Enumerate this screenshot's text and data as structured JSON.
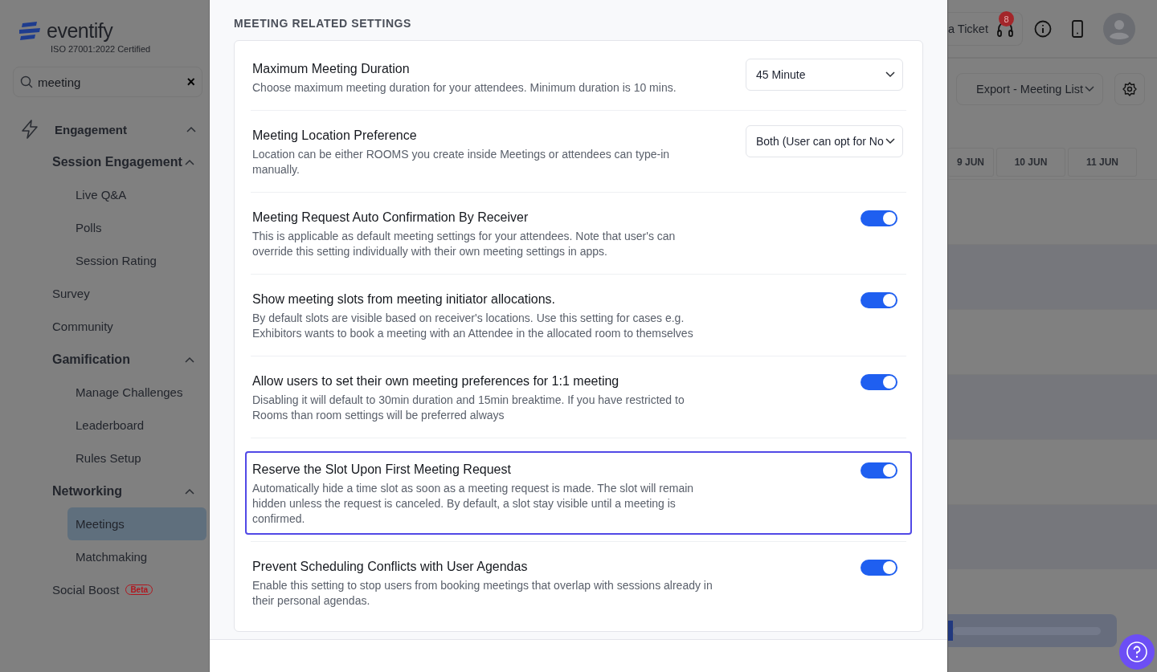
{
  "sidebar": {
    "logo": "eventify",
    "certification": "ISO 27001:2022 Certified",
    "search": {
      "value": "meeting",
      "clear": "×"
    },
    "nav": [
      {
        "label": "Engagement",
        "expanded": true,
        "children": [
          {
            "label": "Session Engagement",
            "expanded": true,
            "children": [
              {
                "label": "Live Q&A",
                "selected": false
              },
              {
                "label": "Polls",
                "selected": false
              },
              {
                "label": "Session Rating",
                "selected": false
              }
            ]
          },
          {
            "label": "Survey",
            "selected": false
          },
          {
            "label": "Community",
            "selected": false
          },
          {
            "label": "Gamification",
            "expanded": true,
            "children": [
              {
                "label": "Manage Challenges",
                "selected": false
              },
              {
                "label": "Leaderboard",
                "selected": false
              },
              {
                "label": "Rules Setup",
                "selected": false
              }
            ]
          },
          {
            "label": "Networking",
            "expanded": true,
            "children": [
              {
                "label": "Meetings",
                "selected": true
              },
              {
                "label": "Matchmaking",
                "selected": false
              }
            ]
          },
          {
            "label": "Social Boost",
            "badge": "Beta",
            "selected": false
          }
        ]
      }
    ]
  },
  "modal": {
    "section_title": "MEETING RELATED SETTINGS",
    "settings": [
      {
        "kind": "select",
        "title": "Maximum Meeting Duration",
        "description": "Choose maximum meeting duration for your attendees. Minimum duration is 10 mins.",
        "value": "45 Minute",
        "selected": false
      },
      {
        "kind": "select",
        "title": "Meeting Location Preference",
        "description": "Location can be either ROOMS you create inside Meetings or attendees can type-in manually.",
        "value": "Both (User can opt for No",
        "selected": false
      },
      {
        "kind": "toggle",
        "title": "Meeting Request Auto Confirmation By Receiver",
        "description": "This is applicable as default meeting settings for your attendees. Note that user's can override this setting individually with their own meeting settings in apps.",
        "on": true,
        "selected": false
      },
      {
        "kind": "toggle",
        "title": "Show meeting slots from meeting initiator allocations.",
        "description": "By default slots are visible based on receiver's locations. Use this setting for cases e.g. Exhibitors wants to book a meeting with an Attendee in the allocated room to themselves",
        "on": true,
        "selected": false
      },
      {
        "kind": "toggle",
        "title": "Allow users to set their own meeting preferences for 1:1 meeting",
        "description": "Disabling it will default to 30min duration and 15min breaktime. If you have restricted to Rooms than room settings will be preferred always",
        "on": true,
        "selected": false
      },
      {
        "kind": "toggle",
        "title": "Reserve the Slot Upon First Meeting Request",
        "description": "Automatically hide a time slot as soon as a meeting request is made. The slot will remain hidden unless the request is canceled. By default, a slot stay visible until a meeting is confirmed.",
        "on": true,
        "selected": true
      },
      {
        "kind": "toggle",
        "title": "Prevent Scheduling Conflicts with User Agendas",
        "description": "Enable this setting to stop users from booking meetings that overlap with sessions already in their personal agendas.",
        "on": true,
        "selected": false
      }
    ]
  },
  "background": {
    "ticket_button": "a Ticket",
    "ticket_badge": "8",
    "export_button": "Export - Meeting List",
    "dates": [
      "9 JUN",
      "10 JUN",
      "11 JUN"
    ]
  }
}
